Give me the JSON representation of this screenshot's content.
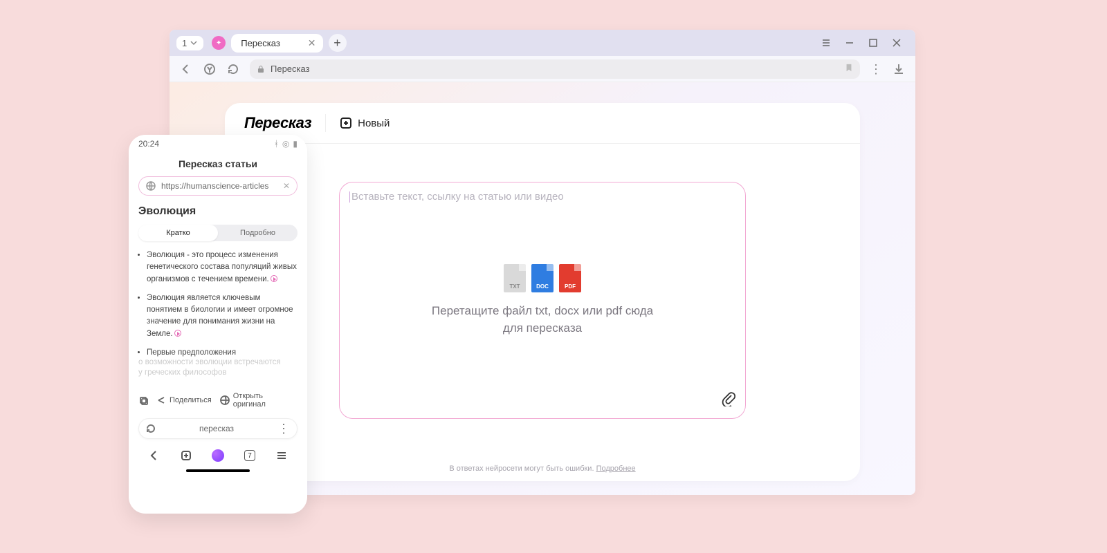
{
  "browser": {
    "tab_count": "1",
    "tab_title": "Пересказ",
    "address": "Пересказ"
  },
  "card": {
    "title": "Пересказ",
    "new_label": "Новый",
    "placeholder": "Вставьте текст, ссылку на статью или видео",
    "file_txt": "TXT",
    "file_doc": "DOC",
    "file_pdf": "PDF",
    "drop_line1": "Перетащите файл txt, docx или pdf сюда",
    "drop_line2": "для пересказа",
    "disclaimer_text": "В ответах нейросети могут быть ошибки. ",
    "disclaimer_link": "Подробнее"
  },
  "phone": {
    "time": "20:24",
    "title": "Пересказ статьи",
    "url": "https://humanscience-articles",
    "heading": "Эволюция",
    "seg_brief": "Кратко",
    "seg_detail": "Подробно",
    "bullets": [
      "Эволюция - это процесс изменения генетического состава популяций живых организмов с течением времени.",
      "Эволюция является ключевым понятием в биологии и имеет огромное значение для понимания жизни на Земле.",
      "Первые предположения"
    ],
    "fade1": "о возможности эволюции встречаются",
    "fade2": "у греческих философов",
    "share": "Поделиться",
    "open_original": "Открыть оригинал",
    "search_query": "пересказ",
    "tabs_count": "7"
  }
}
